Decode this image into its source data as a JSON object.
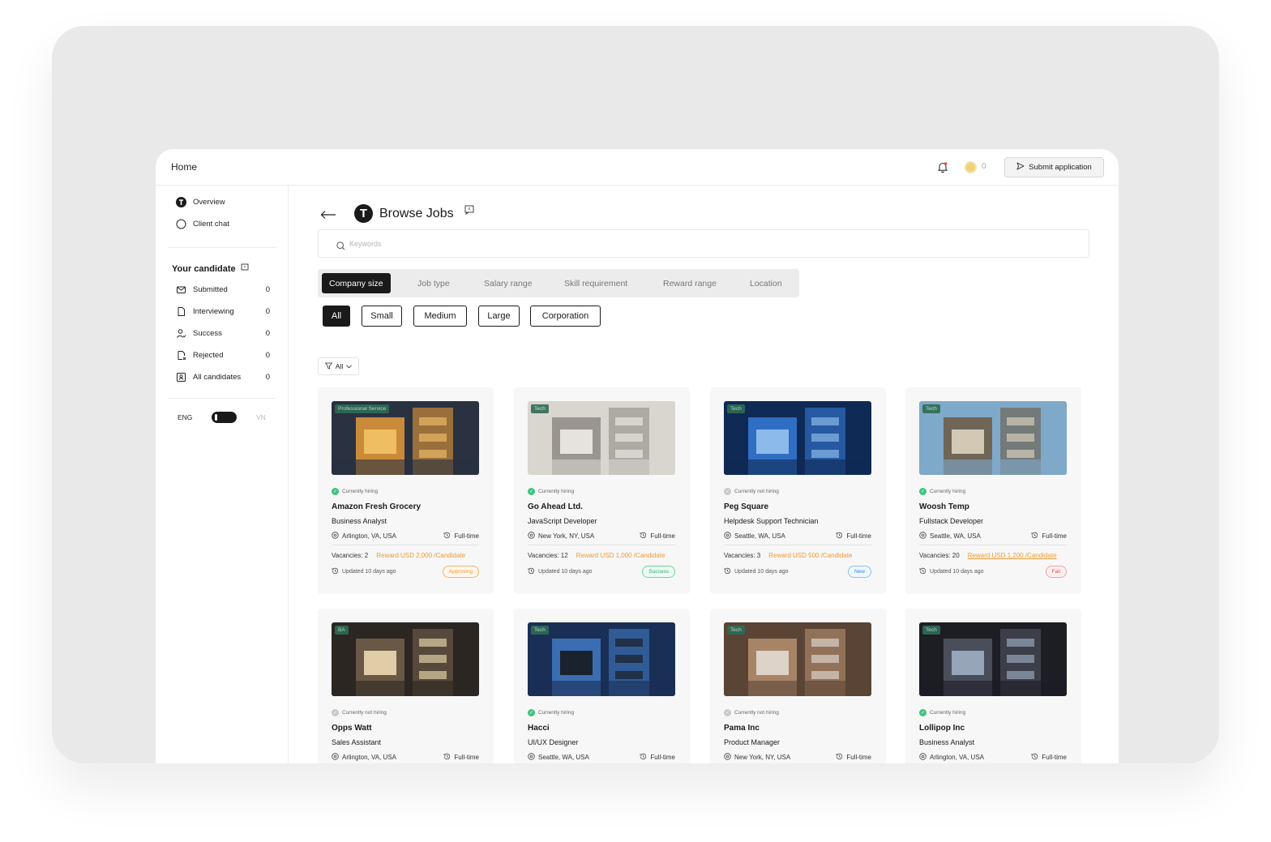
{
  "topbar": {
    "home_label": "Home",
    "coin_count": "0",
    "submit_label": "Submit application"
  },
  "sidebar": {
    "nav": [
      {
        "label": "Overview",
        "icon": "brand-logo-icon"
      },
      {
        "label": "Client chat",
        "icon": "chat-bubble-icon"
      }
    ],
    "section_title": "Your candidate",
    "candidates": [
      {
        "label": "Submitted",
        "count": "0",
        "icon": "mail-icon"
      },
      {
        "label": "Interviewing",
        "count": "0",
        "icon": "document-icon"
      },
      {
        "label": "Success",
        "count": "0",
        "icon": "user-check-icon"
      },
      {
        "label": "Rejected",
        "count": "0",
        "icon": "document-x-icon"
      },
      {
        "label": "All candidates",
        "count": "0",
        "icon": "id-card-icon"
      }
    ],
    "lang_left": "ENG",
    "lang_right": "VN"
  },
  "main": {
    "logo_letter": "T",
    "title": "Browse Jobs",
    "search_placeholder": "Keywords",
    "filter_tabs": [
      "Company size",
      "Job type",
      "Salary range",
      "Skill requirement",
      "Reward range",
      "Location"
    ],
    "chips": [
      "All",
      "Small",
      "Medium",
      "Large",
      "Corporation"
    ],
    "all_filter_label": "All"
  },
  "jobs": [
    {
      "tag": "Professional Service",
      "status": "Currently hiring",
      "hiring": true,
      "company": "Amazon Fresh Grocery",
      "role": "Business Analyst",
      "location": "Arlington, VA, USA",
      "type": "Full-time",
      "vacancies": "Vacancies: 2",
      "reward": "Reward USD 2,000 /Candidate",
      "updated": "Updated 10 days ago",
      "badge": "Approving",
      "badge_kind": "approving",
      "scene_colors": [
        "#2a3140",
        "#c98a3a",
        "#f6c66a"
      ]
    },
    {
      "tag": "Tech",
      "status": "Currently hiring",
      "hiring": true,
      "company": "Go Ahead Ltd.",
      "role": "JavaScript Developer",
      "location": "New York, NY, USA",
      "type": "Full-time",
      "vacancies": "Vacancies: 12",
      "reward": "Reward USD 1,000 /Candidate",
      "updated": "Updated 10 days ago",
      "badge": "Success",
      "badge_kind": "success",
      "scene_colors": [
        "#d9d6d0",
        "#9a9590",
        "#f3f1ec"
      ]
    },
    {
      "tag": "Tech",
      "status": "Currently not hiring",
      "hiring": false,
      "company": "Peg Square",
      "role": "Helpdesk Support Technician",
      "location": "Seattle, WA, USA",
      "type": "Full-time",
      "vacancies": "Vacancies: 3",
      "reward": "Reward USD 500 /Candidate",
      "updated": "Updated 10 days ago",
      "badge": "New",
      "badge_kind": "new",
      "scene_colors": [
        "#0f2a55",
        "#2f6ec2",
        "#9cc8f2"
      ]
    },
    {
      "tag": "Tech",
      "status": "Currently hiring",
      "hiring": true,
      "company": "Woosh Temp",
      "role": "Fullstack Developer",
      "location": "Seattle, WA, USA",
      "type": "Full-time",
      "vacancies": "Vacancies: 20",
      "reward": "Reward USD 1,200 /Candidate",
      "updated": "Updated 10 days ago",
      "badge": "Fail",
      "badge_kind": "fail",
      "scene_colors": [
        "#7fa9c9",
        "#6f6658",
        "#e4d9c4"
      ]
    },
    {
      "tag": "BA",
      "status": "Currently not hiring",
      "hiring": false,
      "company": "Opps Watt",
      "role": "Sales Assistant",
      "location": "Arlington, VA, USA",
      "type": "Full-time",
      "scene_colors": [
        "#2b2622",
        "#6a5846",
        "#f4e2b8"
      ]
    },
    {
      "tag": "Tech",
      "status": "Currently hiring",
      "hiring": true,
      "company": "Hacci",
      "role": "UI/UX Designer",
      "location": "Seattle, WA, USA",
      "type": "Full-time",
      "scene_colors": [
        "#1a2f55",
        "#3b6db3",
        "#151515"
      ]
    },
    {
      "tag": "Tech",
      "status": "Currently not hiring",
      "hiring": false,
      "company": "Pama Inc",
      "role": "Product Manager",
      "location": "New York, NY, USA",
      "type": "Full-time",
      "scene_colors": [
        "#5a4436",
        "#a88466",
        "#e6e1da"
      ]
    },
    {
      "tag": "Tech",
      "status": "Currently hiring",
      "hiring": true,
      "company": "Lollipop Inc",
      "role": "Business Analyst",
      "location": "Arlington, VA, USA",
      "type": "Full-time",
      "scene_colors": [
        "#1d1d24",
        "#4a4d5a",
        "#a3b6c9"
      ]
    }
  ]
}
